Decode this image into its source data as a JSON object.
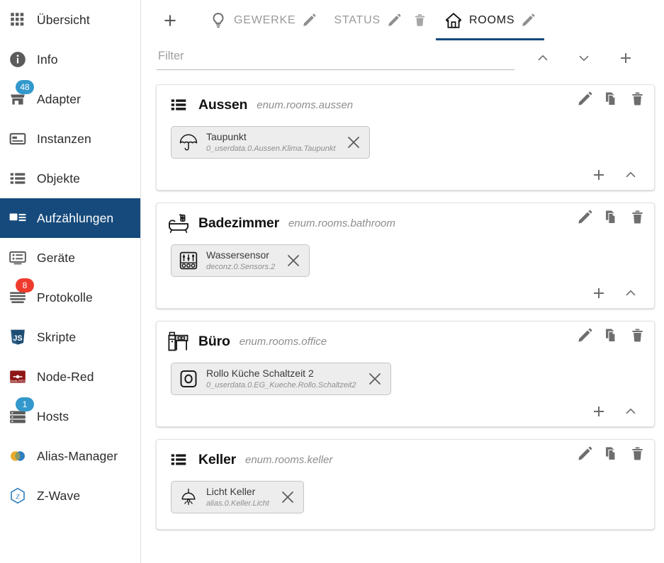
{
  "sidebar": {
    "items": [
      {
        "label": "Übersicht",
        "icon": "grid-icon",
        "selected": false,
        "badge": null
      },
      {
        "label": "Info",
        "icon": "info-icon",
        "selected": false,
        "badge": null
      },
      {
        "label": "Adapter",
        "icon": "shop-icon",
        "selected": false,
        "badge": "48",
        "badge_color": "blue"
      },
      {
        "label": "Instanzen",
        "icon": "instances-icon",
        "selected": false,
        "badge": null
      },
      {
        "label": "Objekte",
        "icon": "list-icon",
        "selected": false,
        "badge": null
      },
      {
        "label": "Aufzählungen",
        "icon": "enums-icon",
        "selected": true,
        "badge": null
      },
      {
        "label": "Geräte",
        "icon": "devices-icon",
        "selected": false,
        "badge": null
      },
      {
        "label": "Protokolle",
        "icon": "logs-icon",
        "selected": false,
        "badge": "8",
        "badge_color": "red"
      },
      {
        "label": "Skripte",
        "icon": "javascript-icon",
        "selected": false,
        "badge": null
      },
      {
        "label": "Node-Red",
        "icon": "node-red-icon",
        "selected": false,
        "badge": null
      },
      {
        "label": "Hosts",
        "icon": "server-icon",
        "selected": false,
        "badge": "1",
        "badge_color": "blue"
      },
      {
        "label": "Alias-Manager",
        "icon": "alias-icon",
        "selected": false,
        "badge": null
      },
      {
        "label": "Z-Wave",
        "icon": "zwave-icon",
        "selected": false,
        "badge": null
      }
    ]
  },
  "colors": {
    "accent": "#164a7c",
    "badge_blue": "#3399cc",
    "badge_red": "#ef3b2d"
  },
  "tabbar": {
    "add_label": "+",
    "tabs": [
      {
        "label": "GEWERKE",
        "icon": "lightbulb-icon",
        "active": false,
        "has_edit": true,
        "has_delete": false
      },
      {
        "label": "STATUS",
        "icon": "",
        "active": false,
        "has_edit": true,
        "has_delete": true
      },
      {
        "label": "ROOMS",
        "icon": "home-icon",
        "active": true,
        "has_edit": true,
        "has_delete": false
      }
    ]
  },
  "filter": {
    "placeholder": "Filter",
    "value": "",
    "actions": [
      {
        "name": "collapse-all",
        "icon": "chevron-up-icon"
      },
      {
        "name": "expand-all",
        "icon": "chevron-down-icon"
      },
      {
        "name": "add-enum",
        "icon": "plus-icon"
      }
    ]
  },
  "cards": [
    {
      "name": "Aussen",
      "id": "enum.rooms.aussen",
      "icon": "list-icon",
      "members": [
        {
          "title": "Taupunkt",
          "id": "0_userdata.0.Aussen.Klima.Taupunkt",
          "icon": "umbrella-icon"
        }
      ],
      "footer": true
    },
    {
      "name": "Badezimmer",
      "id": "enum.rooms.bathroom",
      "icon": "bathtub-icon",
      "members": [
        {
          "title": "Wassersensor",
          "id": "deconz.0.Sensors.2",
          "icon": "sliders-icon"
        }
      ],
      "footer": true
    },
    {
      "name": "Büro",
      "id": "enum.rooms.office",
      "icon": "desk-icon",
      "members": [
        {
          "title": "Rollo Küche Schaltzeit 2",
          "id": "0_userdata.0.EG_Kueche.Rollo.Schaltzeit2",
          "icon": "button-icon"
        }
      ],
      "footer": true
    },
    {
      "name": "Keller",
      "id": "enum.rooms.keller",
      "icon": "list-icon",
      "members": [
        {
          "title": "Licht Keller",
          "id": "alias.0.Keller.Licht",
          "icon": "lamp-icon"
        }
      ],
      "footer": false
    }
  ]
}
